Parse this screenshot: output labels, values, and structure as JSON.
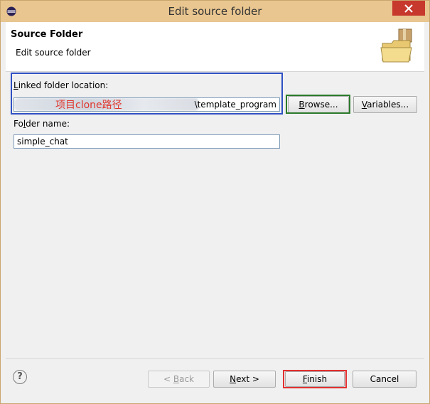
{
  "window": {
    "title": "Edit source folder"
  },
  "header": {
    "title": "Source Folder",
    "subtitle": "Edit source folder"
  },
  "form": {
    "location_label_pre": "L",
    "location_label_rest": "inked folder location:",
    "location_value": "\\template_program",
    "location_overlay_note": "项目clone路径",
    "browse_label_pre": "B",
    "browse_label_rest": "rowse...",
    "variables_label_pre": "V",
    "variables_label_rest": "ariables...",
    "name_label_pre": "Fo",
    "name_label_u": "l",
    "name_label_rest": "der name:",
    "name_value": "simple_chat"
  },
  "footer": {
    "help_label": "?",
    "back_pre": "< ",
    "back_u": "B",
    "back_rest": "ack",
    "next_u": "N",
    "next_rest": "ext >",
    "finish_u": "F",
    "finish_rest": "inish",
    "cancel_label": "Cancel"
  },
  "colors": {
    "highlight_location": "#2f50c4",
    "highlight_browse": "#2c7a2c",
    "highlight_finish": "#e23030",
    "annotation_text": "#e0342c"
  },
  "icons": [
    "eclipse-app-icon",
    "close-icon",
    "folder-package-icon",
    "help-icon"
  ]
}
